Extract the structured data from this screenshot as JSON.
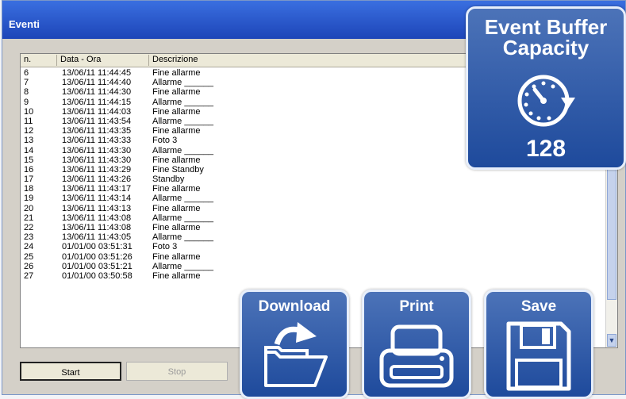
{
  "window": {
    "title": "Eventi"
  },
  "table": {
    "columns": [
      "n.",
      "Data - Ora",
      "Descrizione"
    ],
    "rows": [
      [
        "6",
        "13/06/11 11:44:45",
        "Fine allarme"
      ],
      [
        "7",
        "13/06/11 11:44:40",
        "Allarme ______"
      ],
      [
        "8",
        "13/06/11 11:44:30",
        "Fine allarme"
      ],
      [
        "9",
        "13/06/11 11:44:15",
        "Allarme ______"
      ],
      [
        "10",
        "13/06/11 11:44:03",
        "Fine allarme"
      ],
      [
        "11",
        "13/06/11 11:43:54",
        "Allarme ______"
      ],
      [
        "12",
        "13/06/11 11:43:35",
        "Fine allarme"
      ],
      [
        "13",
        "13/06/11 11:43:33",
        "Foto 3"
      ],
      [
        "14",
        "13/06/11 11:43:30",
        "Allarme ______"
      ],
      [
        "15",
        "13/06/11 11:43:30",
        "Fine allarme"
      ],
      [
        "16",
        "13/06/11 11:43:29",
        "Fine Standby"
      ],
      [
        "17",
        "13/06/11 11:43:26",
        "Standby"
      ],
      [
        "18",
        "13/06/11 11:43:17",
        "Fine allarme"
      ],
      [
        "19",
        "13/06/11 11:43:14",
        "Allarme ______"
      ],
      [
        "20",
        "13/06/11 11:43:13",
        "Fine allarme"
      ],
      [
        "21",
        "13/06/11 11:43:08",
        "Allarme ______"
      ],
      [
        "22",
        "13/06/11 11:43:08",
        "Fine allarme"
      ],
      [
        "23",
        "13/06/11 11:43:05",
        "Allarme ______"
      ],
      [
        "24",
        "01/01/00 03:51:31",
        "Foto 3"
      ],
      [
        "25",
        "01/01/00 03:51:26",
        "Fine allarme"
      ],
      [
        "26",
        "01/01/00 03:51:21",
        "Allarme ______"
      ],
      [
        "27",
        "01/01/00 03:50:58",
        "Fine allarme"
      ]
    ]
  },
  "buttons": {
    "start": "Start",
    "stop": "Stop"
  },
  "badges": {
    "capacity": {
      "line1": "Event Buffer",
      "line2": "Capacity",
      "value": "128",
      "icon": "clock-arrow-icon"
    },
    "download": {
      "label": "Download",
      "icon": "folder-arrow-icon"
    },
    "print": {
      "label": "Print",
      "icon": "printer-icon"
    },
    "save": {
      "label": "Save",
      "icon": "floppy-disk-icon"
    }
  },
  "colors": {
    "badge_top": "#4c73b8",
    "badge_bottom": "#1e4a9c",
    "titlebar": "#2f5fcf"
  }
}
